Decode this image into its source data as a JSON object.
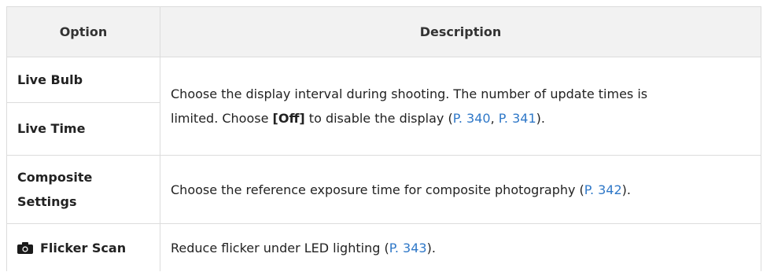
{
  "table": {
    "headers": {
      "option": "Option",
      "description": "Description"
    },
    "rows": {
      "live_bulb": "Live Bulb",
      "live_time": "Live Time",
      "live_desc": {
        "part1": "Choose the display interval during shooting. The number of update times is",
        "part2": "limited. Choose ",
        "off_label": "[Off]",
        "part3": " to disable the display (",
        "link1": "P. 340",
        "sep": ", ",
        "link2": "P. 341",
        "part4": ")."
      },
      "composite_line1": "Composite",
      "composite_line2": "Settings",
      "composite_desc": {
        "text": "Choose the reference exposure time for composite photography (",
        "link": "P. 342",
        "end": ")."
      },
      "flicker_icon": "camera-icon",
      "flicker_label": "Flicker Scan",
      "flicker_desc": {
        "text": "Reduce flicker under LED lighting (",
        "link": "P. 343",
        "end": ")."
      }
    }
  },
  "colors": {
    "link": "#2f78c8",
    "header_bg": "#f2f2f2",
    "border": "#dcdcdc",
    "text": "#222222"
  }
}
